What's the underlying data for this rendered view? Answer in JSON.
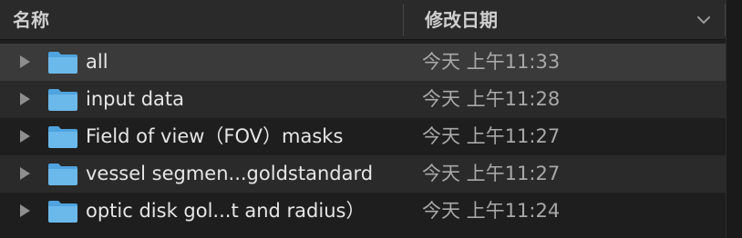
{
  "header": {
    "name_label": "名称",
    "date_label": "修改日期",
    "sort_icon": "chevron-down-icon"
  },
  "files": [
    {
      "name": "all",
      "date": "今天 上午11:33",
      "icon": "folder-icon",
      "selected": true
    },
    {
      "name": "input data",
      "date": "今天 上午11:28",
      "icon": "folder-icon",
      "selected": false
    },
    {
      "name": "Field of view（FOV）masks",
      "date": "今天 上午11:27",
      "icon": "folder-icon",
      "selected": false
    },
    {
      "name": "vessel segmen...goldstandard",
      "date": "今天 上午11:27",
      "icon": "folder-icon",
      "selected": false
    },
    {
      "name": "optic disk gol...t and radius）",
      "date": "今天 上午11:24",
      "icon": "folder-icon",
      "selected": false
    }
  ],
  "colors": {
    "folder": "#6bb8ea",
    "folder_tab": "#4fa3df",
    "selected_row": "#3a3a3a"
  }
}
